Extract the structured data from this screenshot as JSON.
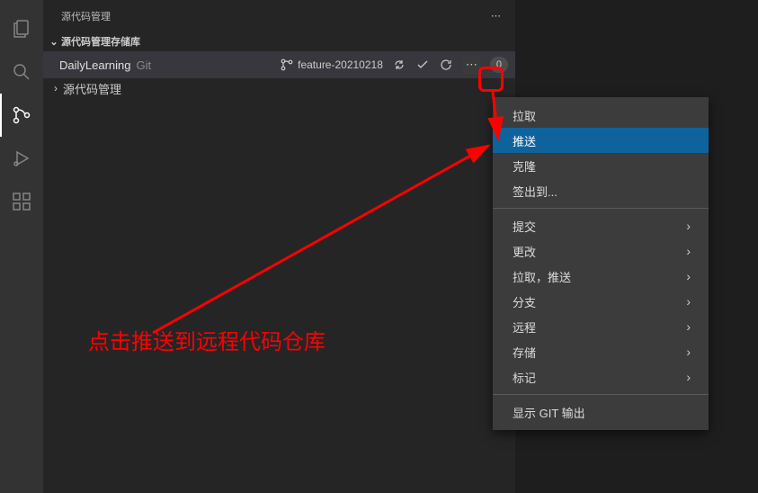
{
  "sidebar": {
    "title": "源代码管理",
    "section_repos": "源代码管理存储库",
    "section_scm": "源代码管理",
    "repo": {
      "name": "DailyLearning",
      "type": "Git",
      "branch": "feature-20210218",
      "count": "0"
    }
  },
  "menu": {
    "pull": "拉取",
    "push": "推送",
    "clone": "克隆",
    "checkout": "签出到...",
    "commit": "提交",
    "changes": "更改",
    "pull_push": "拉取，推送",
    "branch": "分支",
    "remote": "远程",
    "stash": "存储",
    "tag": "标记",
    "show_git_output": "显示 GIT 输出"
  },
  "annotation": "点击推送到远程代码仓库"
}
